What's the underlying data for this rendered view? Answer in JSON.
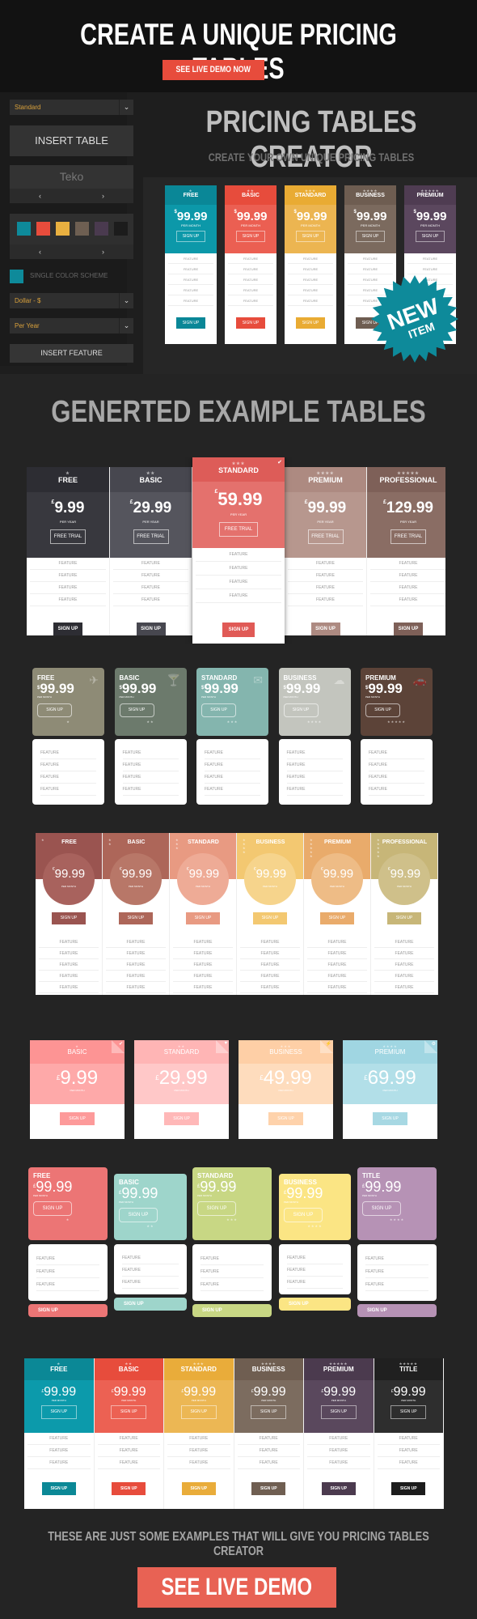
{
  "header": {
    "title": "CREATE A UNIQUE PRICING TABLES",
    "cta_label": "SEE LIVE DEMO NOW",
    "cta_color": "#e74c3c"
  },
  "sidebar": {
    "style_select": "Standard",
    "insert_table_label": "INSERT TABLE",
    "font_name": "Teko",
    "prev_arrow": "‹",
    "next_arrow": "›",
    "swatches": [
      "#0e8a9a",
      "#e74c3c",
      "#e9b040",
      "#6e5f52",
      "#4a3a4f",
      "#1c1c1c"
    ],
    "single_color_label": "SINGLE COLOR SCHEME",
    "single_color_value": "#0e8a9a",
    "currency_select": "Dollar - $",
    "period_select": "Per Year",
    "insert_feature_label": "INSERT FEATURE",
    "chevron": "⌄"
  },
  "creator": {
    "title": "PRICING TABLES CREATOR",
    "subtitle": "CREATE YOUR OWN UNIQUE PRICING TABLES",
    "badge_line1": "NEW",
    "badge_line2": "ITEM",
    "badge_color": "#0e8a9a",
    "preview_plans": [
      {
        "name": "FREE",
        "stars": "★",
        "currency": "$",
        "price": "99.99",
        "period": "PER MONTH",
        "cta": "SIGN UP",
        "color": "#0c98a9",
        "dark": "#0a8797"
      },
      {
        "name": "BASIC",
        "stars": "★★",
        "currency": "$",
        "price": "99.99",
        "period": "PER MONTH",
        "cta": "SIGN UP",
        "color": "#eb5f52",
        "dark": "#e74c3c"
      },
      {
        "name": "STANDARD",
        "stars": "★★★",
        "currency": "$",
        "price": "99.99",
        "period": "PER MONTH",
        "cta": "SIGN UP",
        "color": "#ecb551",
        "dark": "#e9ab33"
      },
      {
        "name": "BUSINESS",
        "stars": "★★★★",
        "currency": "$",
        "price": "99.99",
        "period": "PER MONTH",
        "cta": "SIGN UP",
        "color": "#7b6a5e",
        "dark": "#6e5d51"
      },
      {
        "name": "PREMIUM",
        "stars": "★★★★★",
        "currency": "$",
        "price": "99.99",
        "period": "PER MONTH",
        "cta": "SIGN UP",
        "color": "#5b475e",
        "dark": "#4f3c52"
      }
    ],
    "feature_label": "FEATURE"
  },
  "examples": {
    "title": "GENERTED EXAMPLE TABLES",
    "table1": {
      "plans": [
        {
          "name": "FREE",
          "stars": "★",
          "currency": "£",
          "price": "9.99",
          "period": "PER YEAR",
          "trial": "FREE TRIAL",
          "cta": "SIGN UP",
          "top": "#2d2d33",
          "mid": "#38383e",
          "btn": "#2d2d33"
        },
        {
          "name": "BASIC",
          "stars": "★★",
          "currency": "£",
          "price": "29.99",
          "period": "PER YEAR",
          "trial": "FREE TRIAL",
          "cta": "SIGN UP",
          "top": "#47474f",
          "mid": "#55555d",
          "btn": "#47474f"
        },
        {
          "name": "STANDARD",
          "stars": "★★★",
          "currency": "£",
          "price": "59.99",
          "period": "PER YEAR",
          "trial": "FREE TRIAL",
          "cta": "SIGN UP",
          "top": "#dd5c58",
          "mid": "#e4716d",
          "btn": "#e05a56",
          "featured": true
        },
        {
          "name": "PREMIUM",
          "stars": "★★★★",
          "currency": "£",
          "price": "99.99",
          "period": "PER YEAR",
          "trial": "FREE TRIAL",
          "cta": "SIGN UP",
          "top": "#ad8a81",
          "mid": "#b7978e",
          "btn": "#ad8a81"
        },
        {
          "name": "PROFESSIONAL",
          "stars": "★★★★★",
          "currency": "£",
          "price": "129.99",
          "period": "PER YEAR",
          "trial": "FREE TRIAL",
          "cta": "SIGN UP",
          "top": "#7e6058",
          "mid": "#8a6d64",
          "btn": "#7e6058"
        }
      ],
      "features": [
        "FEATURE",
        "FEATURE",
        "FEATURE",
        "FEATURE"
      ],
      "featured_icon": "✔"
    },
    "table2": {
      "plans": [
        {
          "name": "FREE",
          "currency": "$",
          "price": "99.99",
          "period": "PER MONTH",
          "cta": "SIGN UP",
          "stars": "★",
          "icon": "✈",
          "icon_name": "airplane-icon",
          "color": "#8e8b76"
        },
        {
          "name": "BASIC",
          "currency": "$",
          "price": "99.99",
          "period": "PER MONTH",
          "cta": "SIGN UP",
          "stars": "★★",
          "icon": "🍸",
          "icon_name": "cocktail-icon",
          "color": "#6c7a6c"
        },
        {
          "name": "STANDARD",
          "currency": "$",
          "price": "99.99",
          "period": "PER MONTH",
          "cta": "SIGN UP",
          "stars": "★★★",
          "icon": "✉",
          "icon_name": "envelope-icon",
          "color": "#84b5ae"
        },
        {
          "name": "BUSINESS",
          "currency": "$",
          "price": "99.99",
          "period": "PER MONTH",
          "cta": "SIGN UP",
          "stars": "★★★★",
          "icon": "☁",
          "icon_name": "cloud-icon",
          "color": "#c3c5be"
        },
        {
          "name": "PREMIUM",
          "currency": "$",
          "price": "99.99",
          "period": "PER MONTH",
          "cta": "SIGN UP",
          "stars": "★★★★★",
          "icon": "🚗",
          "icon_name": "car-icon",
          "color": "#5c4338"
        }
      ],
      "features": [
        "FEATURE",
        "FEATURE",
        "FEATURE",
        "FEATURE"
      ]
    },
    "table3": {
      "plans": [
        {
          "name": "FREE",
          "stars": "★",
          "currency": "€",
          "price": "99.99",
          "period": "PER MONTH",
          "cta": "SIGN UP",
          "color": "#9a5450",
          "circle": "#a8625d"
        },
        {
          "name": "BASIC",
          "stars": "★★",
          "currency": "€",
          "price": "99.99",
          "period": "PER MONTH",
          "cta": "SIGN UP",
          "color": "#ad6659",
          "circle": "#b87768"
        },
        {
          "name": "STANDARD",
          "stars": "★★★",
          "currency": "€",
          "price": "99.99",
          "period": "PER MONTH",
          "cta": "SIGN UP",
          "color": "#e89a82",
          "circle": "#eeab96"
        },
        {
          "name": "BUSINESS",
          "stars": "★★★★",
          "currency": "€",
          "price": "99.99",
          "period": "PER MONTH",
          "cta": "SIGN UP",
          "color": "#f3c871",
          "circle": "#f6d48c"
        },
        {
          "name": "PREMIUM",
          "stars": "★★★★★",
          "currency": "€",
          "price": "99.99",
          "period": "PER MONTH",
          "cta": "SIGN UP",
          "color": "#e9ab6b",
          "circle": "#eebc86"
        },
        {
          "name": "PROFESSIONAL",
          "stars": "★★★★★",
          "currency": "€",
          "price": "99.99",
          "period": "PER MONTH",
          "cta": "SIGN UP",
          "color": "#c7b678",
          "circle": "#cfc08a"
        }
      ],
      "features": [
        "FEATURE",
        "FEATURE",
        "FEATURE",
        "FEATURE",
        "FEATURE"
      ]
    },
    "table4": {
      "plans": [
        {
          "name": "BASIC",
          "stars": "★",
          "currency": "£",
          "price": "9.99",
          "period": "PER MONTH",
          "cta": "SIGN UP",
          "top": "#fd9494",
          "mid": "#fea9a9",
          "btn": "#fd9a9a",
          "icon": "✔",
          "icon_name": "check-icon"
        },
        {
          "name": "STANDARD",
          "stars": "★★",
          "currency": "£",
          "price": "29.99",
          "period": "PER MONTH",
          "cta": "SIGN UP",
          "top": "#ffb5b5",
          "mid": "#ffc8c8",
          "btn": "#ffb8b8",
          "icon": "♥",
          "icon_name": "heart-icon"
        },
        {
          "name": "BUSINESS",
          "stars": "★★★",
          "currency": "£",
          "price": "49.99",
          "period": "PER MONTH",
          "cta": "SIGN UP",
          "top": "#fecfa6",
          "mid": "#fedcbd",
          "btn": "#fed2ab",
          "icon": "⚡",
          "icon_name": "lightning-icon"
        },
        {
          "name": "PREMIUM",
          "stars": "★★★★",
          "currency": "£",
          "price": "69.99",
          "period": "PER MONTH",
          "cta": "SIGN UP",
          "top": "#a0d6e2",
          "mid": "#b2dfe8",
          "btn": "#a7d8e3",
          "icon": "⚙",
          "icon_name": "gear-icon"
        }
      ]
    },
    "table5": {
      "plans": [
        {
          "name": "FREE",
          "currency": "£",
          "price": "99.99",
          "period": "PER MONTH",
          "cta": "SIGN UP",
          "stars": "★",
          "color": "#ec7575"
        },
        {
          "name": "BASIC",
          "currency": "£",
          "price": "99.99",
          "period": "PER MONTH",
          "cta": "SIGN UP",
          "stars": "★★",
          "color": "#9ed5cb"
        },
        {
          "name": "STANDARD",
          "currency": "£",
          "price": "99.99",
          "period": "PER MONTH",
          "cta": "SIGN UP",
          "stars": "★★★",
          "color": "#c8d784"
        },
        {
          "name": "BUSINESS",
          "currency": "£",
          "price": "99.99",
          "period": "PER MONTH",
          "cta": "SIGN UP",
          "stars": "★★★★",
          "color": "#fbe584"
        },
        {
          "name": "TITLE",
          "currency": "£",
          "price": "99.99",
          "period": "PER MONTH",
          "cta": "SIGN UP",
          "stars": "★★★★",
          "color": "#b692b5"
        }
      ],
      "features": [
        "FEATURE",
        "FEATURE",
        "FEATURE"
      ]
    },
    "table6": {
      "plans": [
        {
          "name": "FREE",
          "stars": "★",
          "currency": "£",
          "price": "99.99",
          "period": "PER MONTH",
          "cta": "SIGN UP",
          "top": "#0b8896",
          "mid": "#0c9aab",
          "btn": "#0b8896"
        },
        {
          "name": "BASIC",
          "stars": "★★",
          "currency": "£",
          "price": "99.99",
          "period": "PER MONTH",
          "cta": "SIGN UP",
          "top": "#e74c3c",
          "mid": "#ec6153",
          "btn": "#e74c3c"
        },
        {
          "name": "STANDARD",
          "stars": "★★★",
          "currency": "£",
          "price": "99.99",
          "period": "PER MONTH",
          "cta": "SIGN UP",
          "top": "#e9ac3a",
          "mid": "#ecb754",
          "btn": "#e9ac3a"
        },
        {
          "name": "BUSINESS",
          "stars": "★★★★",
          "currency": "£",
          "price": "99.99",
          "period": "PER MONTH",
          "cta": "SIGN UP",
          "top": "#6f5e51",
          "mid": "#7c6c5f",
          "btn": "#6f5e51"
        },
        {
          "name": "PREMIUM",
          "stars": "★★★★★",
          "currency": "£",
          "price": "99.99",
          "period": "PER MONTH",
          "cta": "SIGN UP",
          "top": "#4b3a4e",
          "mid": "#5a485d",
          "btn": "#4b3a4e"
        },
        {
          "name": "TITLE",
          "stars": "★★★★★",
          "currency": "£",
          "price": "99.99",
          "period": "PER MONTH",
          "cta": "SIGN UP",
          "top": "#202020",
          "mid": "#2e2e2e",
          "btn": "#1c1c1c"
        }
      ],
      "features": [
        "FEATURE",
        "FEATURE",
        "FEATURE"
      ]
    }
  },
  "footer": {
    "text": "THESE ARE JUST SOME EXAMPLES THAT WILL GIVE YOU PRICING TABLES CREATOR",
    "cta_label": "SEE LIVE DEMO"
  }
}
